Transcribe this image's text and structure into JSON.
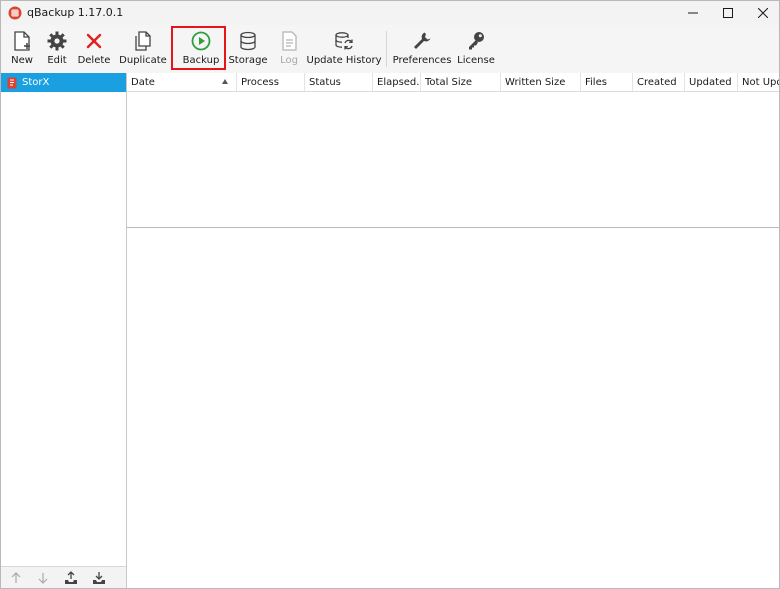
{
  "window": {
    "title": "qBackup 1.17.0.1"
  },
  "toolbar": {
    "new_label": "New",
    "edit_label": "Edit",
    "delete_label": "Delete",
    "duplicate_label": "Duplicate",
    "backup_label": "Backup",
    "storage_label": "Storage",
    "log_label": "Log",
    "update_history_label": "Update History",
    "preferences_label": "Preferences",
    "license_label": "License"
  },
  "sidebar": {
    "items": [
      {
        "label": "StorX",
        "selected": true
      }
    ]
  },
  "table": {
    "columns": [
      "Date",
      "Process",
      "Status",
      "Elapsed...",
      "Total Size",
      "Written Size",
      "Files",
      "Created",
      "Updated",
      "Not Upd..."
    ],
    "sort_column": "Date",
    "sort_direction": "ascending",
    "rows": []
  },
  "colors": {
    "accent": "#1a9fe0",
    "highlight": "#e8141b",
    "backup_icon": "#2e9e3e",
    "delete_icon": "#e0201c"
  }
}
